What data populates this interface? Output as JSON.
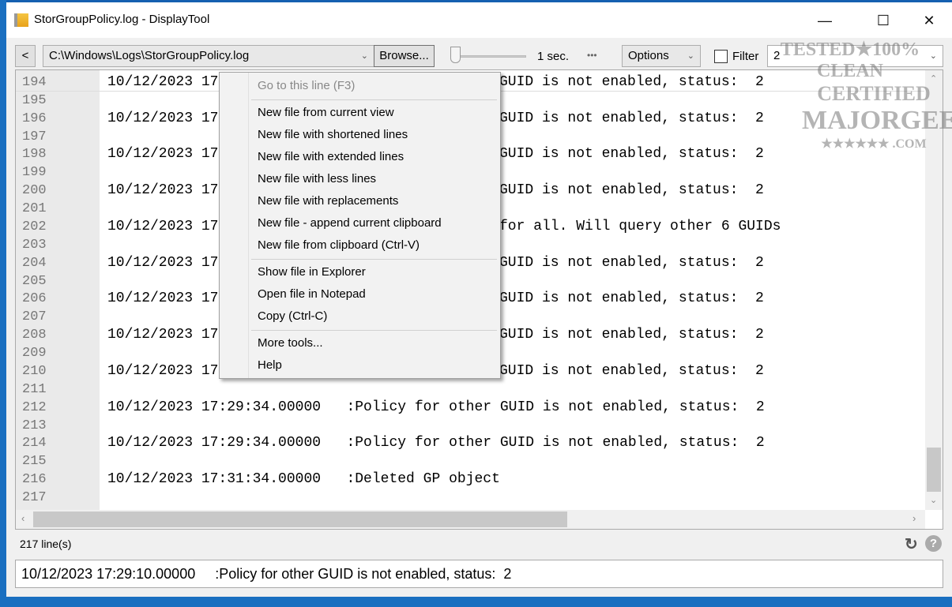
{
  "window": {
    "title": "StorGroupPolicy.log - DisplayTool",
    "controls": {
      "minimize": "—",
      "maximize": "☐",
      "close": "✕"
    }
  },
  "toolbar": {
    "back_label": "<",
    "path": "C:\\Windows\\Logs\\StorGroupPolicy.log",
    "browse_label": "Browse...",
    "interval": "1 sec.",
    "more_label": "•••",
    "options_label": "Options",
    "filter_label": "Filter",
    "filter_checked": false,
    "filter_value": "2",
    "slider_value": 0
  },
  "lines": [
    {
      "n": "194",
      "text": "10/12/2023 17",
      "right": "GUID is not enabled, status:  2"
    },
    {
      "n": "195",
      "text": "",
      "right": ""
    },
    {
      "n": "196",
      "text": "10/12/2023 17",
      "right": "GUID is not enabled, status:  2"
    },
    {
      "n": "197",
      "text": "",
      "right": ""
    },
    {
      "n": "198",
      "text": "10/12/2023 17",
      "right": "GUID is not enabled, status:  2"
    },
    {
      "n": "199",
      "text": "",
      "right": ""
    },
    {
      "n": "200",
      "text": "10/12/2023 17",
      "right": "GUID is not enabled, status:  2"
    },
    {
      "n": "201",
      "text": "",
      "right": ""
    },
    {
      "n": "202",
      "text": "10/12/2023 17",
      "right": "for all. Will query other 6 GUIDs"
    },
    {
      "n": "203",
      "text": "",
      "right": ""
    },
    {
      "n": "204",
      "text": "10/12/2023 17",
      "right": "GUID is not enabled, status:  2"
    },
    {
      "n": "205",
      "text": "",
      "right": ""
    },
    {
      "n": "206",
      "text": "10/12/2023 17",
      "right": "GUID is not enabled, status:  2"
    },
    {
      "n": "207",
      "text": "",
      "right": ""
    },
    {
      "n": "208",
      "text": "10/12/2023 17",
      "right": "GUID is not enabled, status:  2"
    },
    {
      "n": "209",
      "text": "",
      "right": ""
    },
    {
      "n": "210",
      "text": "10/12/2023 17",
      "right": "GUID is not enabled, status:  2"
    },
    {
      "n": "211",
      "text": "",
      "right": ""
    },
    {
      "n": "212",
      "text": "10/12/2023 17:29:34.00000   :Policy for other GUID is not enabled, status:  2",
      "right": ""
    },
    {
      "n": "213",
      "text": "",
      "right": ""
    },
    {
      "n": "214",
      "text": "10/12/2023 17:29:34.00000   :Policy for other GUID is not enabled, status:  2",
      "right": ""
    },
    {
      "n": "215",
      "text": "",
      "right": ""
    },
    {
      "n": "216",
      "text": "10/12/2023 17:31:34.00000   :Deleted GP object",
      "right": ""
    },
    {
      "n": "217",
      "text": "",
      "right": ""
    }
  ],
  "context_menu": {
    "items": [
      "Go to this line (F3)",
      "New file from current view",
      "New file with shortened lines",
      "New file with extended lines",
      "New file with less lines",
      "New file with replacements",
      "New file - append current clipboard",
      "New file from clipboard (Ctrl-V)",
      "Show file in Explorer",
      "Open file in Notepad",
      "Copy (Ctrl-C)",
      "More tools...",
      "Help"
    ]
  },
  "status": {
    "line_count": "217 line(s)",
    "refresh_icon": "refresh-icon",
    "help_icon": "?"
  },
  "detail": {
    "text": "10/12/2023 17:29:10.00000     :Policy for other GUID is not enabled, status:  2"
  },
  "watermark": {
    "line1": "TESTED★100% CLEAN",
    "line2": "CERTIFIED",
    "line3": "MAJORGEEKS",
    "line4": "★★★★★★ .COM"
  }
}
